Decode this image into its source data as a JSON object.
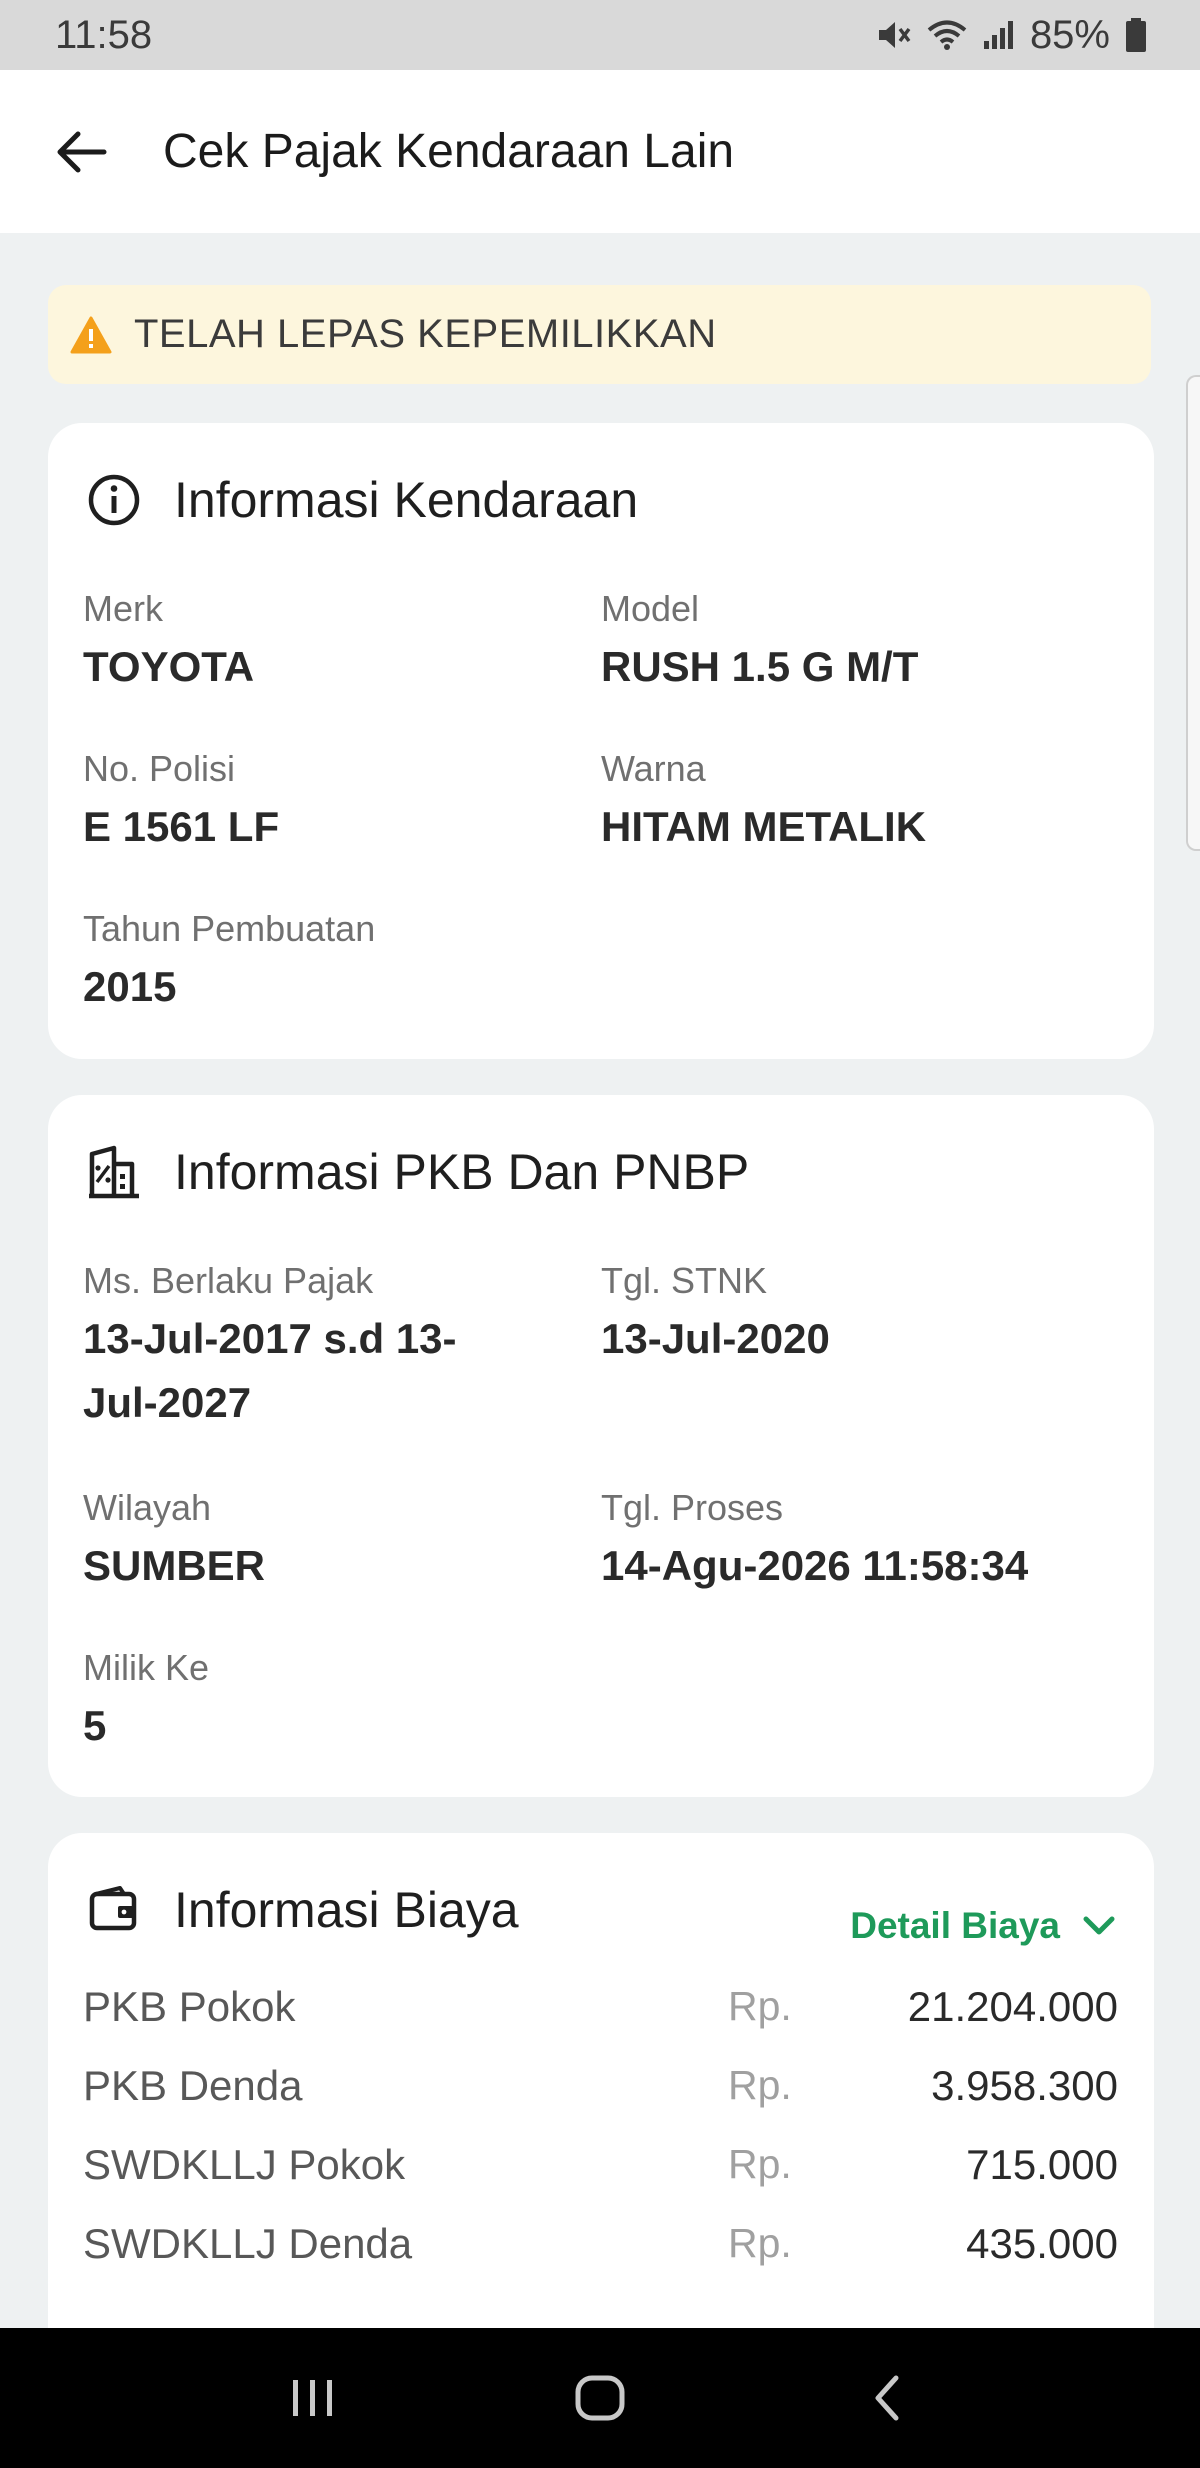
{
  "status_bar": {
    "time": "11:58",
    "battery": "85%"
  },
  "app_bar": {
    "title": "Cek Pajak Kendaraan Lain"
  },
  "alert": {
    "text": "TELAH LEPAS KEPEMILIKKAN",
    "color": "#f4a01b"
  },
  "vehicle_info": {
    "title": "Informasi Kendaraan",
    "merk_label": "Merk",
    "merk_value": "TOYOTA",
    "model_label": "Model",
    "model_value": "RUSH 1.5 G M/T",
    "polisi_label": "No. Polisi",
    "polisi_value": "E 1561 LF",
    "warna_label": "Warna",
    "warna_value": "HITAM METALIK",
    "tahun_label": "Tahun Pembuatan",
    "tahun_value": "2015"
  },
  "pkb_info": {
    "title": "Informasi PKB Dan PNBP",
    "berlaku_label": "Ms. Berlaku Pajak",
    "berlaku_value_line1": "13-Jul-2017 s.d 13-",
    "berlaku_value_line2": "Jul-2027",
    "stnk_label": "Tgl. STNK",
    "stnk_value": "13-Jul-2020",
    "wilayah_label": "Wilayah",
    "wilayah_value": "SUMBER",
    "proses_label": "Tgl. Proses",
    "proses_value": "14-Agu-2026 11:58:34",
    "milik_label": "Milik Ke",
    "milik_value": "5"
  },
  "cost_info": {
    "title": "Informasi Biaya",
    "detail_label": "Detail Biaya",
    "accent": "#1e9a5a",
    "rows": [
      {
        "label": "PKB Pokok",
        "currency": "Rp.",
        "amount": "21.204.000"
      },
      {
        "label": "PKB Denda",
        "currency": "Rp.",
        "amount": "3.958.300"
      },
      {
        "label": "SWDKLLJ Pokok",
        "currency": "Rp.",
        "amount": "715.000"
      },
      {
        "label": "SWDKLLJ Denda",
        "currency": "Rp.",
        "amount": "435.000"
      }
    ]
  },
  "icons": {
    "back": "arrow-left-icon",
    "alert": "warning-icon",
    "info": "info-icon",
    "pkb": "building-percent-icon",
    "wallet": "wallet-icon",
    "chevron": "chevron-down-icon"
  }
}
